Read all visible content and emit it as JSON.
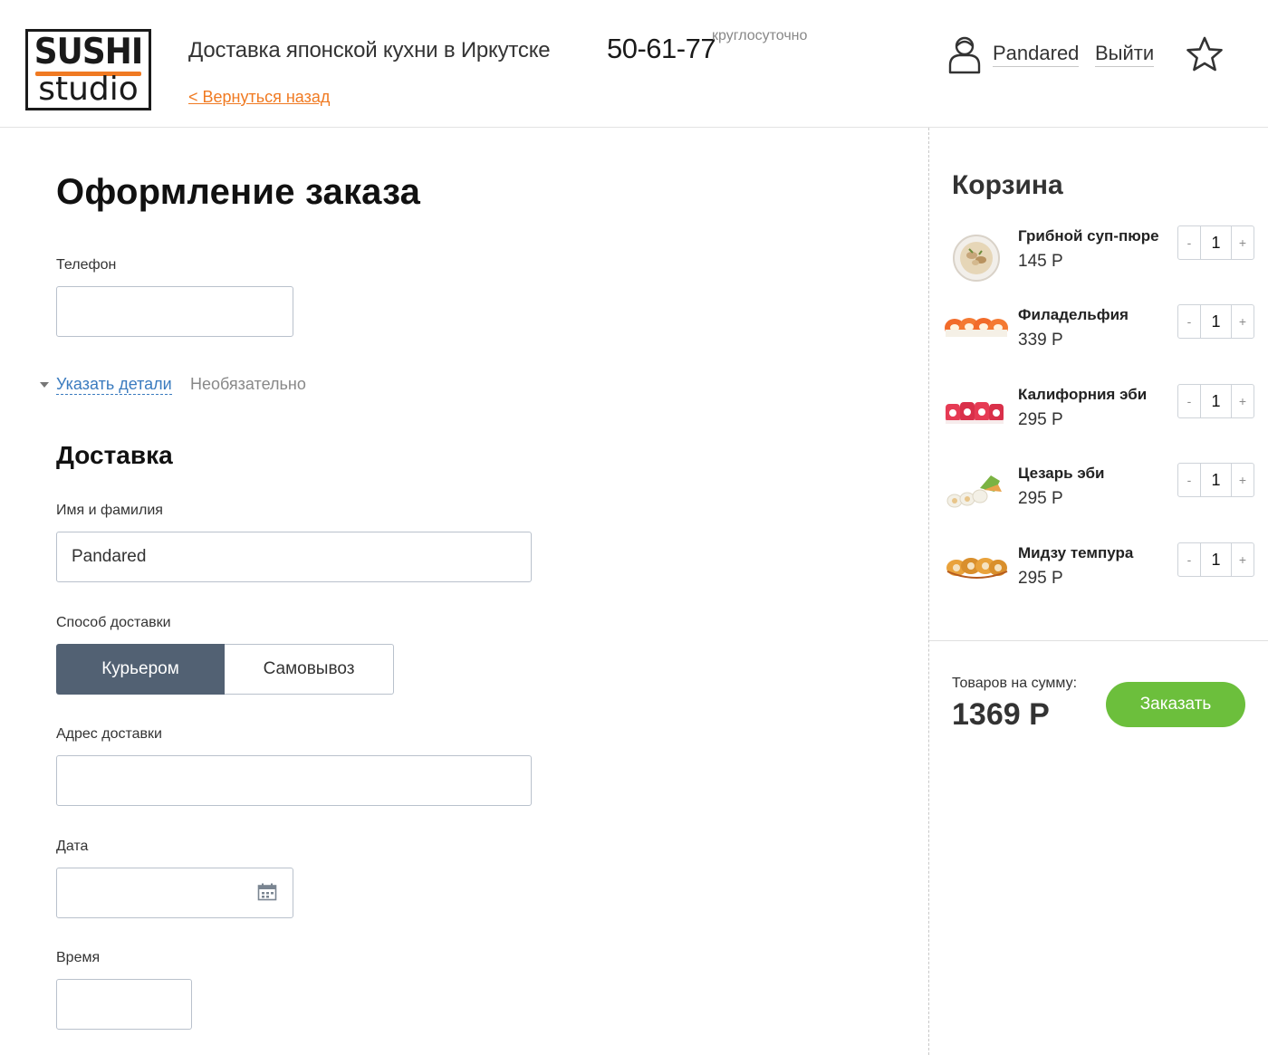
{
  "header": {
    "logo": {
      "line1": "SUSHI",
      "line2": "studio"
    },
    "tagline": "Доставка японской кухни в Иркутске",
    "back_link": "< Вернуться назад",
    "phone": "50-61-77",
    "hours": "круглосуточно",
    "user_name": "Pandared",
    "logout": "Выйти"
  },
  "form": {
    "title": "Оформление заказа",
    "phone_label": "Телефон",
    "phone_value": "",
    "details_link": "Указать детали",
    "details_optional": "Необязательно",
    "delivery_title": "Доставка",
    "name_label": "Имя и фамилия",
    "name_value": "Pandared",
    "method_label": "Способ доставки",
    "method_options": [
      "Курьером",
      "Самовывоз"
    ],
    "method_selected": "Курьером",
    "address_label": "Адрес доставки",
    "address_value": "",
    "date_label": "Дата",
    "date_value": "",
    "time_label": "Время",
    "time_value": ""
  },
  "cart": {
    "title": "Корзина",
    "items": [
      {
        "name": "Грибной суп-пюре",
        "price": "145 Р",
        "qty": "1",
        "image": "mushroom-soup"
      },
      {
        "name": "Филадельфия",
        "price": "339 Р",
        "qty": "1",
        "image": "philadelphia-roll"
      },
      {
        "name": "Калифорния эби",
        "price": "295 Р",
        "qty": "1",
        "image": "california-ebi-roll"
      },
      {
        "name": "Цезарь эби",
        "price": "295 Р",
        "qty": "1",
        "image": "caesar-ebi-roll"
      },
      {
        "name": "Мидзу темпура",
        "price": "295 Р",
        "qty": "1",
        "image": "mizu-tempura-roll"
      }
    ],
    "stepper_minus": "-",
    "stepper_plus": "+",
    "total_label": "Товаров на сумму:",
    "total_value": "1369 Р",
    "order_button": "Заказать"
  },
  "colors": {
    "accent_orange": "#f07a22",
    "link_blue": "#3a7bbf",
    "active_segment": "#526173",
    "order_green": "#6cbf3c"
  }
}
